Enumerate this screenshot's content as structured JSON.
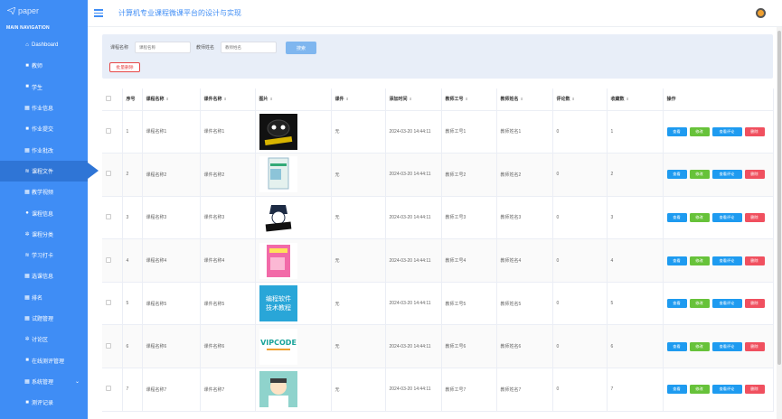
{
  "logo": {
    "text": "paper"
  },
  "sidebar": {
    "section_title": "MAIN NAVIGATION",
    "items": [
      {
        "label": "Dashboard",
        "icon": "home-icon",
        "glyph": "⌂"
      },
      {
        "label": "教师",
        "icon": "user-icon",
        "glyph": "■"
      },
      {
        "label": "学生",
        "icon": "user-icon",
        "glyph": "■"
      },
      {
        "label": "作业信息",
        "icon": "grid-icon",
        "glyph": "▦"
      },
      {
        "label": "作业提交",
        "icon": "comment-icon",
        "glyph": "■"
      },
      {
        "label": "作业批改",
        "icon": "grid-icon",
        "glyph": "▦"
      },
      {
        "label": "课程文件",
        "icon": "layers-icon",
        "glyph": "≋"
      },
      {
        "label": "教学视频",
        "icon": "grid-icon",
        "glyph": "▦"
      },
      {
        "label": "课程信息",
        "icon": "pin-icon",
        "glyph": "●"
      },
      {
        "label": "课程分类",
        "icon": "gear-icon",
        "glyph": "✲"
      },
      {
        "label": "学习打卡",
        "icon": "layers-icon",
        "glyph": "≋"
      },
      {
        "label": "选课信息",
        "icon": "grid-icon",
        "glyph": "▦"
      },
      {
        "label": "排名",
        "icon": "grid-icon",
        "glyph": "▦"
      },
      {
        "label": "试题管理",
        "icon": "grid-icon",
        "glyph": "▦"
      },
      {
        "label": "讨论区",
        "icon": "gear-icon",
        "glyph": "✲"
      },
      {
        "label": "在线测评管理",
        "icon": "user-icon",
        "glyph": "■"
      },
      {
        "label": "系统管理",
        "icon": "grid-icon",
        "glyph": "▦",
        "chevron": "⌄"
      },
      {
        "label": "测评记录",
        "icon": "comment-icon",
        "glyph": "■"
      }
    ],
    "active_index": 6
  },
  "header": {
    "title": "计算机专业课程微课平台的设计与实现"
  },
  "search": {
    "course_label": "课程名称",
    "course_placeholder": "课程名称",
    "teacher_label": "教师姓名",
    "teacher_placeholder": "教师姓名",
    "search_button": "搜索",
    "batch_delete": "批量删除"
  },
  "table": {
    "columns": [
      "序号",
      "课程名称",
      "课件名称",
      "图片",
      "课件",
      "添加时间",
      "教师工号",
      "教师姓名",
      "评论数",
      "收藏数",
      "操作"
    ],
    "actions": {
      "view": "查看",
      "edit": "修改",
      "comments": "查看评论",
      "delete": "删除"
    },
    "rows": [
      {
        "no": "1",
        "course": "课程名称1",
        "courseware": "课件名称1",
        "image": "book-cover-1",
        "file": "无",
        "time": "2024-03-20 14:44:11",
        "teacher_no": "教师工号1",
        "teacher_name": "教师姓名1",
        "comments": "0",
        "favorites": "1"
      },
      {
        "no": "2",
        "course": "课程名称2",
        "courseware": "课件名称2",
        "image": "book-cover-2",
        "file": "无",
        "time": "2024-03-20 14:44:11",
        "teacher_no": "教师工号2",
        "teacher_name": "教师姓名2",
        "comments": "0",
        "favorites": "2"
      },
      {
        "no": "3",
        "course": "课程名称3",
        "courseware": "课件名称3",
        "image": "book-cover-3",
        "file": "无",
        "time": "2024-03-20 14:44:11",
        "teacher_no": "教师工号3",
        "teacher_name": "教师姓名3",
        "comments": "0",
        "favorites": "3"
      },
      {
        "no": "4",
        "course": "课程名称4",
        "courseware": "课件名称4",
        "image": "book-cover-4",
        "file": "无",
        "time": "2024-03-20 14:44:11",
        "teacher_no": "教师工号4",
        "teacher_name": "教师姓名4",
        "comments": "0",
        "favorites": "4"
      },
      {
        "no": "5",
        "course": "课程名称5",
        "courseware": "课件名称5",
        "image": "book-cover-5",
        "image_text": "编程软件\n技术教程",
        "file": "无",
        "time": "2024-03-20 14:44:11",
        "teacher_no": "教师工号5",
        "teacher_name": "教师姓名5",
        "comments": "0",
        "favorites": "5"
      },
      {
        "no": "6",
        "course": "课程名称6",
        "courseware": "课件名称6",
        "image": "book-cover-6",
        "image_text": "VIPCODE",
        "file": "无",
        "time": "2024-03-20 14:44:11",
        "teacher_no": "教师工号6",
        "teacher_name": "教师姓名6",
        "comments": "0",
        "favorites": "6"
      },
      {
        "no": "7",
        "course": "课程名称7",
        "courseware": "课件名称7",
        "image": "book-cover-7",
        "file": "无",
        "time": "2024-03-20 14:44:11",
        "teacher_no": "教师工号7",
        "teacher_name": "教师姓名7",
        "comments": "0",
        "favorites": "7"
      }
    ]
  },
  "colors": {
    "sidebar": "#3f8df5",
    "sidebar_active": "#2f75d6",
    "view": "#1e9bf0",
    "edit": "#67c23a",
    "delete": "#f0505f"
  }
}
